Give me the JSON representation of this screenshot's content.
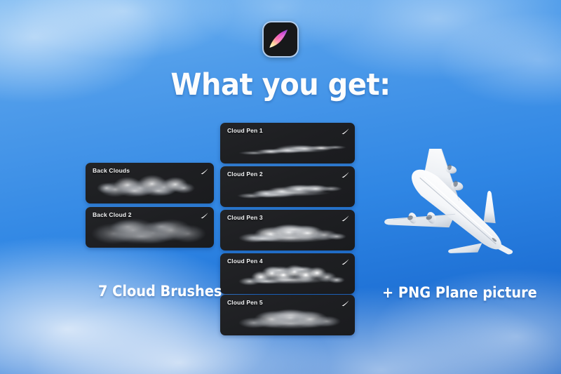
{
  "app": {
    "icon_name": "procreate-app-icon",
    "icon_colors": {
      "background": "#17181a",
      "border": "#bedcff",
      "swoosh_start": "#fff6cc",
      "swoosh_mid": "#ff5fa2",
      "swoosh_end": "#8a3fd1"
    }
  },
  "header": {
    "title": "What you get:"
  },
  "background": {
    "name": "blue-sky-with-clouds",
    "sky_top": "#6eb2f0",
    "sky_bottom": "#1b63c4",
    "cloud_color": "#ffffff"
  },
  "brushes": {
    "left_column": [
      {
        "label": "Back Clouds",
        "preview": "wide-puffy-cloud-stroke",
        "pen_icon": "brush-stroke-icon"
      },
      {
        "label": "Back Cloud 2",
        "preview": "soft-hazy-cloud-stroke",
        "pen_icon": "brush-stroke-icon"
      }
    ],
    "right_column": [
      {
        "label": "Cloud Pen 1",
        "preview": "thin-wispy-streak-stroke",
        "pen_icon": "brush-stroke-icon"
      },
      {
        "label": "Cloud Pen 2",
        "preview": "medium-streaky-cloud-stroke",
        "pen_icon": "brush-stroke-icon"
      },
      {
        "label": "Cloud Pen 3",
        "preview": "dense-billowy-cloud-stroke",
        "pen_icon": "brush-stroke-icon"
      },
      {
        "label": "Cloud Pen 4",
        "preview": "crisp-detailed-puff-stroke",
        "pen_icon": "brush-stroke-icon"
      },
      {
        "label": "Cloud Pen 5",
        "preview": "soft-uniform-cloud-stroke",
        "pen_icon": "brush-stroke-icon"
      }
    ]
  },
  "captions": {
    "brushes": "7 Cloud Brushes",
    "plane": "+ PNG Plane picture"
  },
  "plane": {
    "name": "white-airliner-top-view",
    "body_color": "#ffffff",
    "shade_color": "#c3cbd6"
  }
}
